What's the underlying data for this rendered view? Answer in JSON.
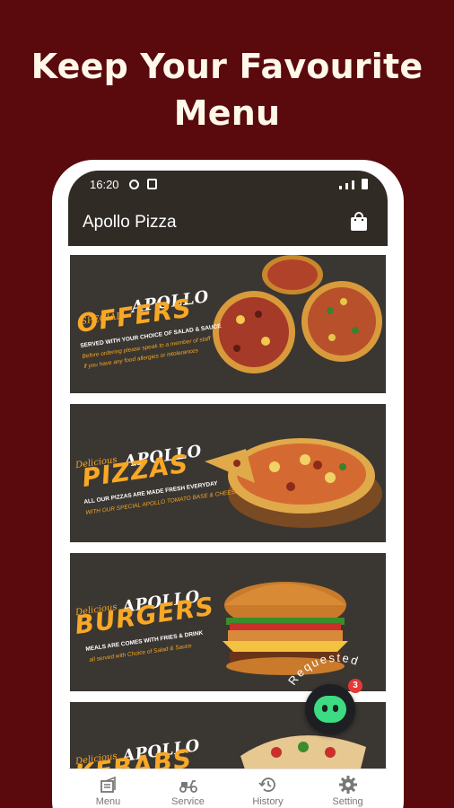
{
  "headline": {
    "line1": "Keep Your Favourite",
    "line2": "Menu"
  },
  "status_bar": {
    "time": "16:20"
  },
  "app_bar": {
    "title": "Apollo Pizza",
    "bag_icon": "shopping-bag-icon"
  },
  "cards": [
    {
      "kicker": "SPECIAL",
      "brand": "APOLLO",
      "headline": "OFFERS",
      "line1": "SERVED WITH YOUR CHOICE OF SALAD & SAUCE",
      "line2": "Before ordering please speak to a member of staff",
      "line3": "if you have any food allergies or intolerances"
    },
    {
      "kicker": "Delicious",
      "brand": "APOLLO",
      "headline": "PIZZAS",
      "line1": "ALL OUR PIZZAS ARE MADE FRESH EVERYDAY",
      "line2": "WITH OUR SPECIAL APOLLO TOMATO BASE & CHEESE"
    },
    {
      "kicker": "Delicious",
      "brand": "APOLLO",
      "headline": "BURGERS",
      "line1": "MEALS ARE COMES WITH FRIES & DRINK",
      "line2": "all served with Choice of Salad & Sauce"
    },
    {
      "kicker": "Delicious",
      "brand": "APOLLO",
      "headline": "KEBABS"
    }
  ],
  "requested": {
    "label": "Requested",
    "badge": "3",
    "icon": "android-robot-icon"
  },
  "bottom_nav": [
    {
      "label": "Menu",
      "icon": "menu-icon"
    },
    {
      "label": "Service",
      "icon": "scooter-icon"
    },
    {
      "label": "History",
      "icon": "history-icon"
    },
    {
      "label": "Setting",
      "icon": "gear-icon"
    }
  ],
  "colors": {
    "background": "#5a0a0c",
    "app_bar": "#302b25",
    "accent": "#f9a825",
    "fab": "#3ddc84"
  }
}
